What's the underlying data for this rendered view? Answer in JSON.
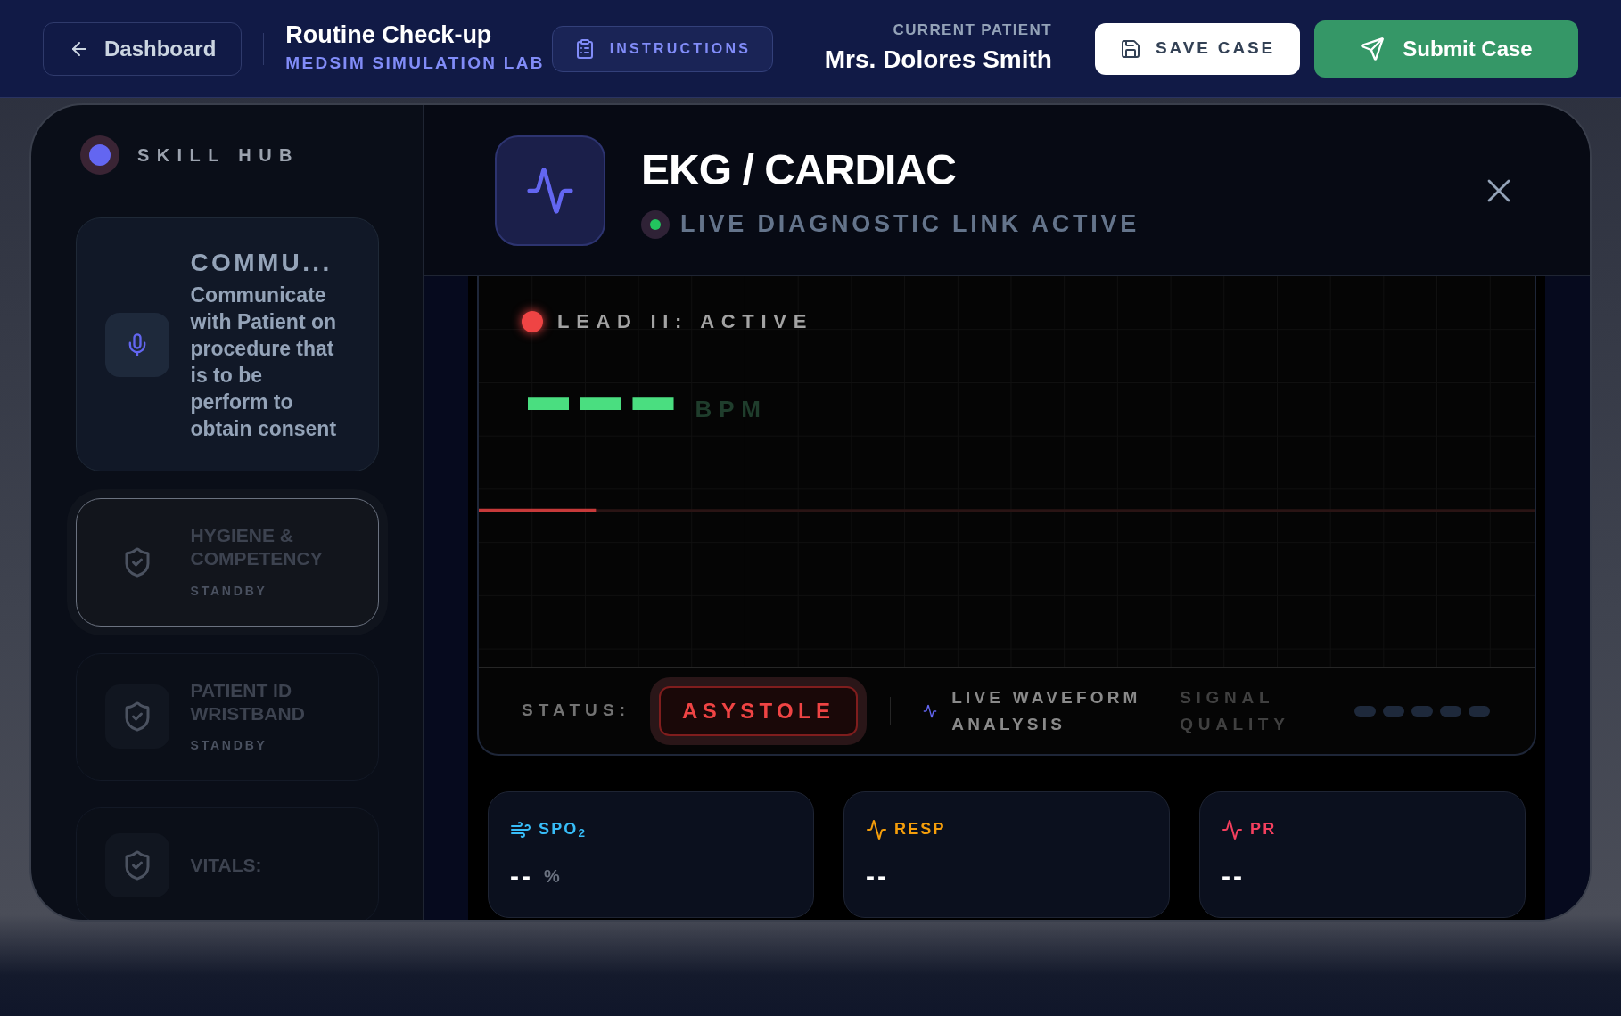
{
  "header": {
    "back_button": "Dashboard",
    "title": "Routine Check-up",
    "subtitle": "MEDSIM SIMULATION LAB",
    "instructions_button": "INSTRUCTIONS",
    "patient_label": "CURRENT PATIENT",
    "patient_name": "Mrs. Dolores Smith",
    "save_button": "SAVE CASE",
    "submit_button": "Submit Case"
  },
  "sidebar": {
    "title": "SKILL HUB",
    "items": [
      {
        "kind": "mic",
        "title": "COMMU...",
        "description": "Communicate with Patient on procedure that is to be perform to obtain consent",
        "active": true,
        "selected": false
      },
      {
        "kind": "shield",
        "title": "HYGIENE & COMPETENCY",
        "status": "STANDBY",
        "active": false,
        "selected": true
      },
      {
        "kind": "shield",
        "title": "PATIENT ID WRISTBAND",
        "status": "STANDBY",
        "active": false,
        "selected": false
      },
      {
        "kind": "shield",
        "title": "VITALS:",
        "active": false,
        "selected": false
      }
    ]
  },
  "panel": {
    "title": "EKG / CARDIAC",
    "link_status": "LIVE DIAGNOSTIC LINK ACTIVE",
    "monitor": {
      "lead": "LEAD II: ACTIVE",
      "bpm_value": "▬ ▬ ▬",
      "bpm_unit": "BPM",
      "status_label": "STATUS:",
      "status": "ASYSTOLE",
      "analysis": "LIVE WAVEFORM ANALYSIS",
      "signal_label": "SIGNAL QUALITY"
    },
    "metrics": [
      {
        "kind": "wind",
        "label": "SPO$_{2}$",
        "value": "--",
        "unit": "%",
        "color": "#38bdf8"
      },
      {
        "kind": "pulse",
        "label": "RESP",
        "value": "--",
        "color": "#f59e0b"
      },
      {
        "kind": "pulse",
        "label": "PR",
        "value": "--",
        "color": "#f43f5e"
      }
    ]
  }
}
